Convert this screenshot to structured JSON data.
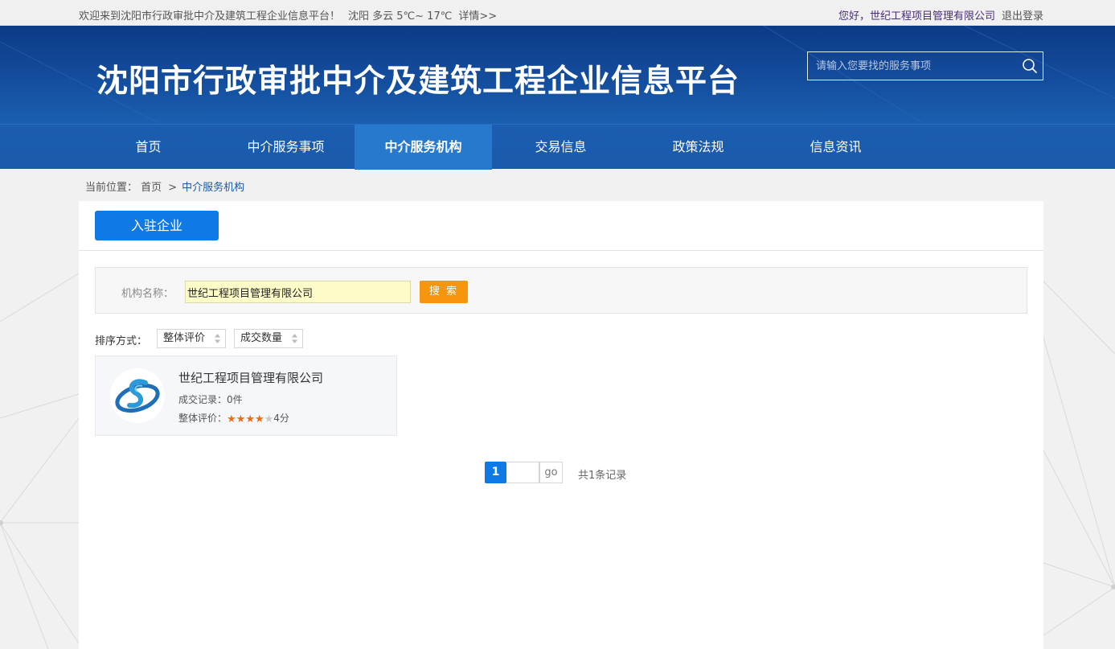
{
  "topbar": {
    "welcome": "欢迎来到沈阳市行政审批中介及建筑工程企业信息平台！",
    "weather": "沈阳 多云 5℃~ 17℃",
    "weather_details": "详情>>",
    "greeting": "您好，",
    "company": "世纪工程项目管理有限公司",
    "logout": "退出登录"
  },
  "header": {
    "title": "沈阳市行政审批中介及建筑工程企业信息平台",
    "search_placeholder": "请输入您要找的服务事项",
    "search_icon": "search-icon"
  },
  "nav": {
    "items": [
      {
        "label": "首页"
      },
      {
        "label": "中介服务事项"
      },
      {
        "label": "中介服务机构",
        "active": true
      },
      {
        "label": "交易信息"
      },
      {
        "label": "政策法规"
      },
      {
        "label": "信息资讯"
      }
    ]
  },
  "breadcrumb": {
    "prefix": "当前位置：",
    "home": "首页",
    "separator": ">",
    "current": "中介服务机构"
  },
  "tabs": {
    "join_button": "入驻企业"
  },
  "filter": {
    "name_label": "机构名称：",
    "name_value": "世纪工程项目管理有限公司",
    "search_button": "搜 索"
  },
  "sort": {
    "label": "排序方式：",
    "options": [
      "整体评价",
      "成交数量"
    ]
  },
  "results": [
    {
      "name": "世纪工程项目管理有限公司",
      "deals_label": "成交记录：",
      "deals_value": "0件",
      "rating_label": "整体评价：",
      "rating": 4,
      "rating_max": 5,
      "rating_text": "4分"
    }
  ],
  "pagination": {
    "current_page": "1",
    "go_label": "go",
    "total_text": "共1条记录"
  },
  "colors": {
    "brand_blue": "#0f7ae5",
    "header_blue": "#154f9f",
    "nav_active": "#2679cc",
    "search_orange": "#f7950f",
    "star_orange": "#f26a10"
  }
}
